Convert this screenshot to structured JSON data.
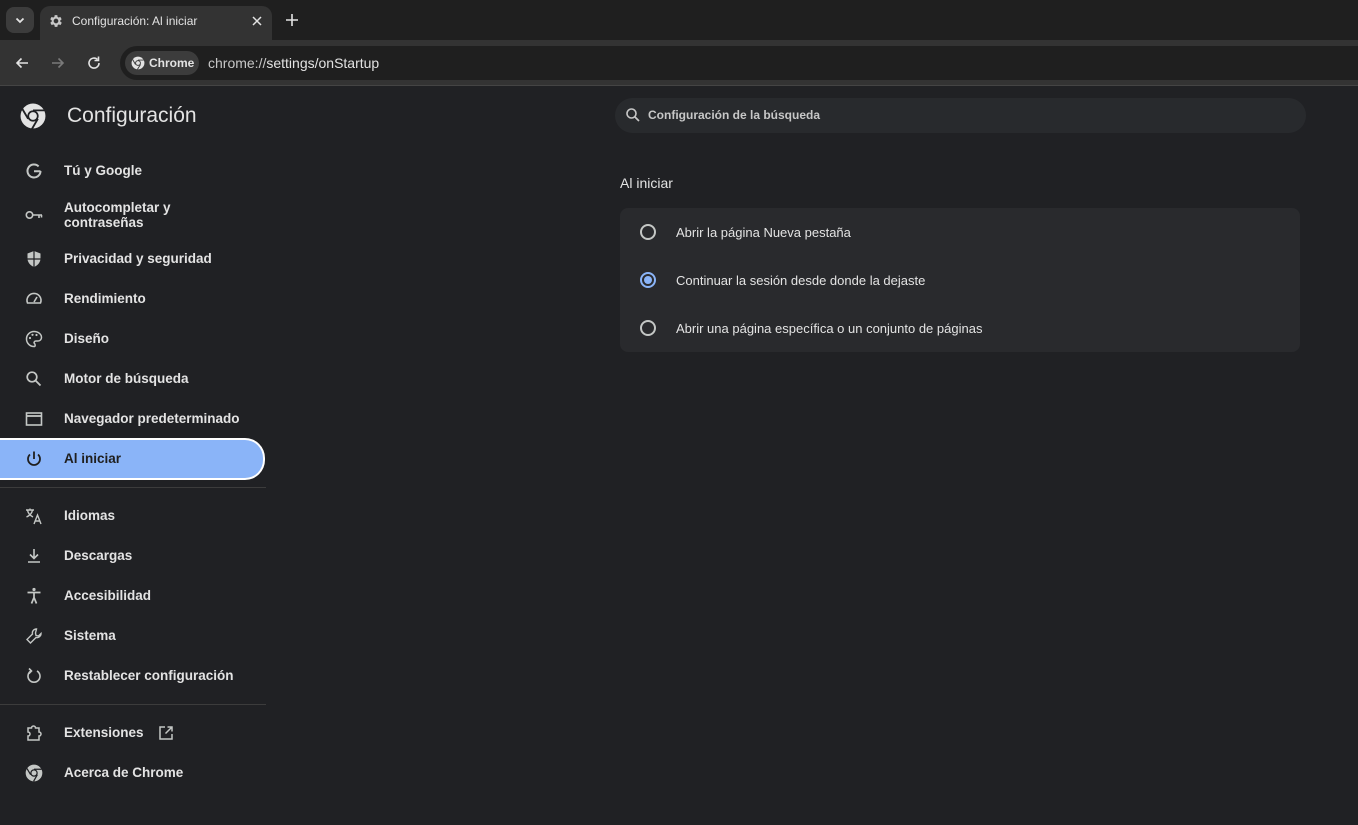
{
  "browser": {
    "tab_title": "Configuración: Al iniciar",
    "chip_label": "Chrome",
    "url_scheme": "chrome://",
    "url_path": "settings/onStartup"
  },
  "sidebar": {
    "title": "Configuración",
    "items": [
      {
        "label": "Tú y Google",
        "icon": "google-g-icon"
      },
      {
        "label": "Autocompletar y contraseñas",
        "icon": "key-icon"
      },
      {
        "label": "Privacidad y seguridad",
        "icon": "shield-icon"
      },
      {
        "label": "Rendimiento",
        "icon": "speedometer-icon"
      },
      {
        "label": "Diseño",
        "icon": "palette-icon"
      },
      {
        "label": "Motor de búsqueda",
        "icon": "search-icon"
      },
      {
        "label": "Navegador predeterminado",
        "icon": "browser-window-icon"
      },
      {
        "label": "Al iniciar",
        "icon": "power-icon",
        "active": true
      },
      {
        "label": "Idiomas",
        "icon": "translate-icon"
      },
      {
        "label": "Descargas",
        "icon": "download-icon"
      },
      {
        "label": "Accesibilidad",
        "icon": "accessibility-icon"
      },
      {
        "label": "Sistema",
        "icon": "wrench-icon"
      },
      {
        "label": "Restablecer configuración",
        "icon": "reset-icon"
      },
      {
        "label": "Extensiones",
        "icon": "puzzle-icon"
      },
      {
        "label": "Acerca de Chrome",
        "icon": "chrome-icon"
      }
    ]
  },
  "search": {
    "placeholder": "Configuración de la búsqueda"
  },
  "section": {
    "title": "Al iniciar",
    "options": [
      {
        "label": "Abrir la página Nueva pestaña",
        "checked": false
      },
      {
        "label": "Continuar la sesión desde donde la dejaste",
        "checked": true
      },
      {
        "label": "Abrir una página específica o un conjunto de páginas",
        "checked": false
      }
    ]
  },
  "colors": {
    "background": "#202124",
    "accent": "#8ab4f8",
    "card": "#292a2d"
  }
}
